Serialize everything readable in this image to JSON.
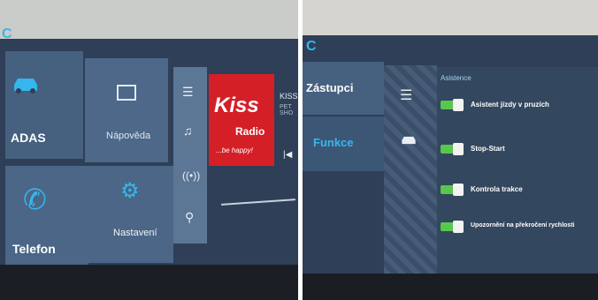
{
  "left_screen": {
    "tiles": [
      {
        "label": "ADAS",
        "icon": "car-icon"
      },
      {
        "label": "Nápověda",
        "icon": "book-icon"
      },
      {
        "label": "Telefon",
        "icon": "phone-icon"
      },
      {
        "label": "Nastavení",
        "icon": "gear-icon"
      }
    ],
    "toolbar_icons": [
      "menu-icon",
      "music-icon",
      "radio-signal-icon",
      "search-icon"
    ],
    "radio": {
      "logo_text": "Kiss",
      "logo_sub": "Radio",
      "slogan": "...be happy!",
      "station": "KISS",
      "subtitle": "PET SHO"
    }
  },
  "right_screen": {
    "left_menu": [
      {
        "label": "Zástupci"
      },
      {
        "label": "Funkce"
      }
    ],
    "section_title": "Asistence",
    "toggles": [
      {
        "label": "Asistent jízdy v pruzích",
        "state": "on"
      },
      {
        "label": "Stop-Start",
        "state": "on"
      },
      {
        "label": "Kontrola trakce",
        "state": "on"
      },
      {
        "label": "Upozornění na překročení rychlosti",
        "state": "on"
      }
    ]
  }
}
